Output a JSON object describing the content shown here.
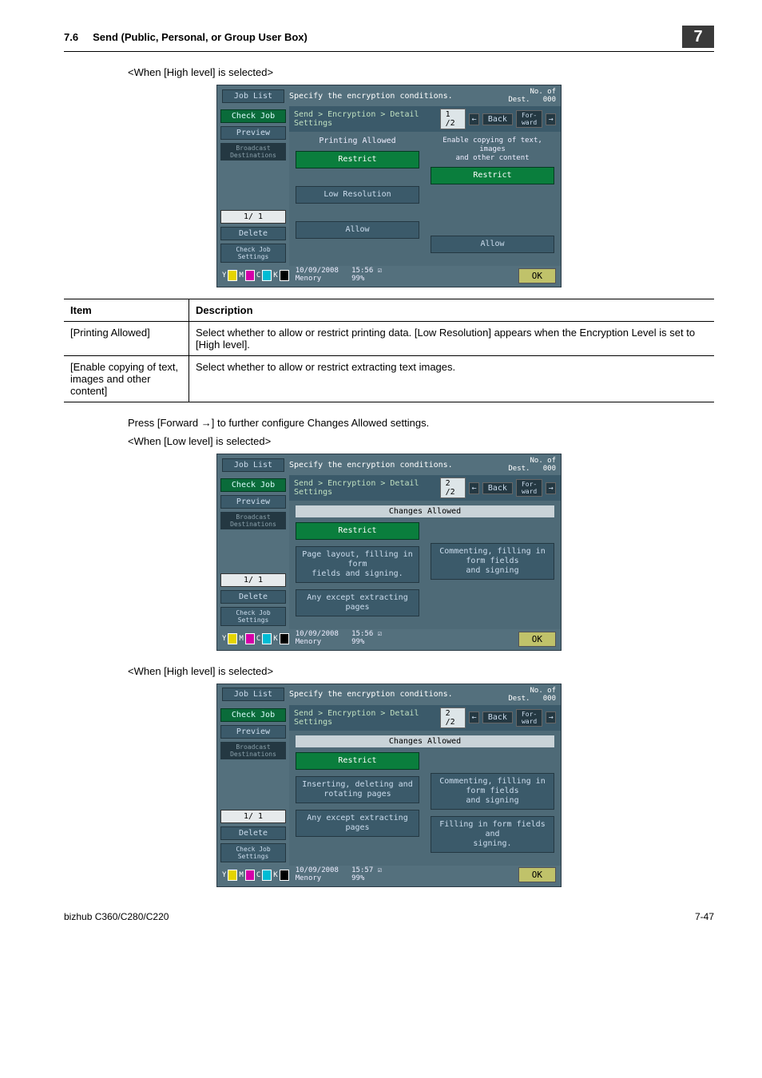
{
  "header": {
    "section_no": "7.6",
    "title": "Send (Public, Personal, or Group User Box)",
    "chapter_badge": "7"
  },
  "captions": {
    "high1": "<When [High level] is selected>",
    "forward": "Press [Forward →] to further configure Changes Allowed settings.",
    "low": "<When [Low level] is selected>",
    "high2": "<When [High level] is selected>"
  },
  "table": {
    "head_item": "Item",
    "head_desc": "Description",
    "rows": [
      {
        "item": "[Printing Allowed]",
        "desc": "Select whether to allow or restrict printing data. [Low Resolution] appears when the Encryption Level is set to [High level]."
      },
      {
        "item": "[Enable copying of text, images and other content]",
        "desc": "Select whether to allow or restrict extracting text images."
      }
    ]
  },
  "device_common": {
    "job_list": "Job List",
    "check_job": "Check Job",
    "preview": "Preview",
    "broadcast": "Broadcast\nDestinations",
    "page_ind": "1/  1",
    "delete": "Delete",
    "check_set": "Check Job\nSettings",
    "top_text": "Specify the encryption conditions.",
    "dest_label": "No. of\nDest.",
    "dest_count": "000",
    "breadcrumb": "Send > Encryption > Detail Settings",
    "back": "Back",
    "forw": "For-\nward",
    "ok": "OK",
    "memory": "Menory",
    "mem_pct": "99%"
  },
  "screen1": {
    "page": "1 /2",
    "col1_head": "Printing Allowed",
    "col2_head": "Enable copying of text, images\nand other content",
    "restrict": "Restrict",
    "lowres": "Low Resolution",
    "allow": "Allow",
    "date": "10/09/2008",
    "time": "15:56"
  },
  "screen2": {
    "page": "2 /2",
    "strip": "Changes Allowed",
    "restrict": "Restrict",
    "opt1": "Page layout, filling in form\nfields and signing.",
    "opt2": "Commenting, filling in form fields\nand signing",
    "opt3": "Any except extracting pages",
    "date": "10/09/2008",
    "time": "15:56"
  },
  "screen3": {
    "page": "2 /2",
    "strip": "Changes Allowed",
    "restrict": "Restrict",
    "opt1": "Inserting, deleting and\nrotating pages",
    "opt2": "Commenting, filling in form fields\nand signing",
    "opt3": "Any except extracting pages",
    "opt4": "Filling in form fields and\nsigning.",
    "date": "10/09/2008",
    "time": "15:57"
  },
  "footer": {
    "model": "bizhub C360/C280/C220",
    "page": "7-47"
  }
}
